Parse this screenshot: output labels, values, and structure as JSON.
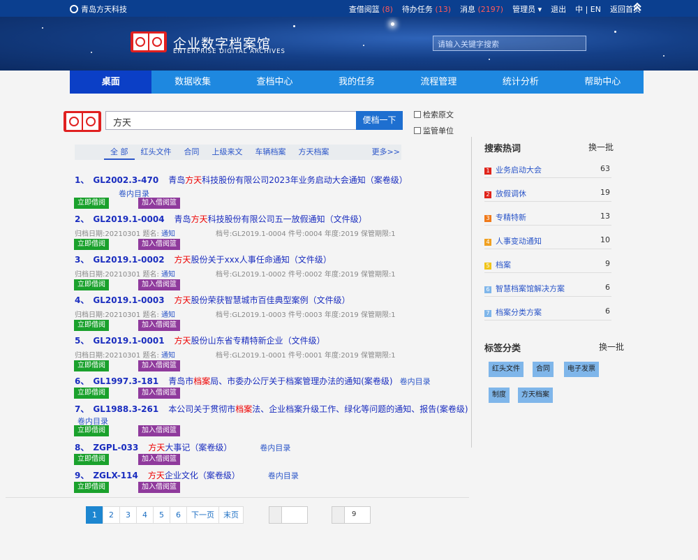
{
  "topbar": {
    "company": "青岛方天科技",
    "links": [
      {
        "label": "查借阅篮",
        "count": "(8)"
      },
      {
        "label": "待办任务",
        "count": "(13)"
      },
      {
        "label": "消息",
        "count": "(2197)"
      },
      {
        "label": "管理员 ▾",
        "count": ""
      },
      {
        "label": "退出",
        "count": ""
      },
      {
        "label": "中 | EN",
        "count": ""
      },
      {
        "label": "返回首页",
        "count": ""
      }
    ]
  },
  "banner": {
    "title": "企业数字档案馆",
    "subtitle": "ENTERPRISE DIGITAL ARCHIVES",
    "search_placeholder": "请输入关键字搜索"
  },
  "nav": [
    "桌面",
    "数据收集",
    "查档中心",
    "我的任务",
    "流程管理",
    "统计分析",
    "帮助中心"
  ],
  "search": {
    "value": "方天",
    "button": "便档一下",
    "opt1": "检索原文",
    "opt2": "监管单位"
  },
  "tabs": {
    "items": [
      "全 部",
      "红头文件",
      "合同",
      "上级来文",
      "车辆档案",
      "方天档案"
    ],
    "more": "更多>>"
  },
  "actions": {
    "borrow": "立即借阅",
    "add": "加入借阅篮"
  },
  "results": [
    {
      "no": "1、",
      "code": "GL2002.3-470",
      "pre": "青岛",
      "hi": "方天",
      "post": "科技股份有限公司2023年业务启动大会通知（案卷级）",
      "sub": "卷内目录",
      "meta": null
    },
    {
      "no": "2、",
      "code": "GL2019.1-0004",
      "pre": "青岛",
      "hi": "方天",
      "post": "科技股份有限公司五一放假通知（文件级）",
      "sub": "",
      "meta": {
        "date": "归档日期:20210301",
        "title_l": "题名:",
        "title_v": "通知",
        "rest": "档号:GL2019.1-0004 件号:0004 年度:2019 保管期限:1"
      }
    },
    {
      "no": "3、",
      "code": "GL2019.1-0002",
      "pre": "",
      "hi": "方天",
      "post": "股份关于xxx人事任命通知（文件级）",
      "sub": "",
      "meta": {
        "date": "归档日期:20210301",
        "title_l": "题名:",
        "title_v": "通知",
        "rest": "档号:GL2019.1-0002 件号:0002 年度:2019 保管期限:1"
      }
    },
    {
      "no": "4、",
      "code": "GL2019.1-0003",
      "pre": "",
      "hi": "方天",
      "post": "股份荣获智慧城市百佳典型案例（文件级）",
      "sub": "",
      "meta": {
        "date": "归档日期:20210301",
        "title_l": "题名:",
        "title_v": "通知",
        "rest": "档号:GL2019.1-0003 件号:0003 年度:2019 保管期限:1"
      }
    },
    {
      "no": "5、",
      "code": "GL2019.1-0001",
      "pre": "",
      "hi": "方天",
      "post": "股份山东省专精特新企业（文件级）",
      "sub": "",
      "meta": {
        "date": "归档日期:20210301",
        "title_l": "题名:",
        "title_v": "通知",
        "rest": "档号:GL2019.1-0001 件号:0001 年度:2019 保管期限:1"
      }
    },
    {
      "no": "6、",
      "code": "GL1997.3-181",
      "pre": "青岛市",
      "hi": "档案",
      "post": "局、市委办公厅关于档案管理办法的通知(案卷级)",
      "sub": "卷内目录",
      "meta": null
    },
    {
      "no": "7、",
      "code": "GL1988.3-261",
      "pre": "本公司关于贯彻市",
      "hi": "档案",
      "post": "法、企业档案升级工作、绿化等问题的通知、报告(案卷级)",
      "sub": "卷内目录",
      "meta": null
    },
    {
      "no": "8、",
      "code": "ZGPL-033",
      "pre": "",
      "hi": "方天",
      "post": "大事记（案卷级）",
      "sub": "卷内目录",
      "meta": null
    },
    {
      "no": "9、",
      "code": "ZGLX-114",
      "pre": "",
      "hi": "方天",
      "post": "企业文化（案卷级）",
      "sub": "卷内目录",
      "meta": null
    }
  ],
  "pager": {
    "pages": [
      "1",
      "2",
      "3",
      "4",
      "5",
      "6"
    ],
    "next": "下一页",
    "last": "末页",
    "goto_value": "",
    "page_size": "9"
  },
  "hot": {
    "title": "搜索热词",
    "change": "换一批",
    "items": [
      {
        "rank": "1",
        "label": "业务启动大会",
        "count": "63",
        "color": "#e0241b"
      },
      {
        "rank": "2",
        "label": "放假调休",
        "count": "19",
        "color": "#e0241b"
      },
      {
        "rank": "3",
        "label": "专精特新",
        "count": "13",
        "color": "#f07a1a"
      },
      {
        "rank": "4",
        "label": "人事变动通知",
        "count": "10",
        "color": "#f0a020"
      },
      {
        "rank": "5",
        "label": "档案",
        "count": "9",
        "color": "#f0c419"
      },
      {
        "rank": "6",
        "label": "智慧档案馆解决方案",
        "count": "6",
        "color": "#7fb6ea"
      },
      {
        "rank": "7",
        "label": "档案分类方案",
        "count": "6",
        "color": "#7fb6ea"
      }
    ]
  },
  "tags": {
    "title": "标签分类",
    "change": "换一批",
    "items": [
      "红头文件",
      "合同",
      "电子发票",
      "制度",
      "方天档案"
    ]
  }
}
